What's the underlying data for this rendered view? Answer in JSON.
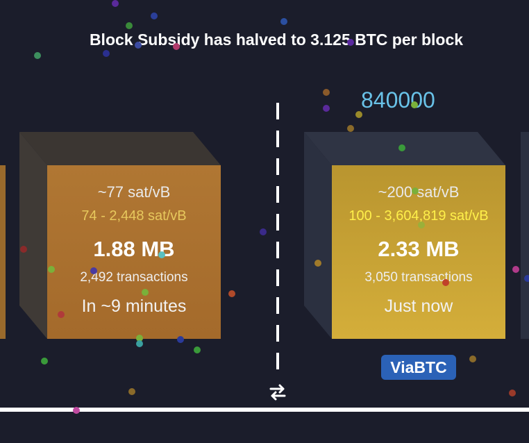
{
  "headline": "Block Subsidy has halved to 3.125 BTC per block",
  "block_height": "840000",
  "blocks": [
    {
      "fee": "~77 sat/vB",
      "fee_range": "74 - 2,448 sat/vB",
      "size": "1.88 MB",
      "transactions": "2,492 transactions",
      "time": "In ~9 minutes"
    },
    {
      "fee": "~200 sat/vB",
      "fee_range": "100 - 3,604,819 sat/vB",
      "size": "2.33 MB",
      "transactions": "3,050 transactions",
      "time": "Just now",
      "pool": "ViaBTC"
    }
  ],
  "colors": {
    "background": "#1b1d2b",
    "mempool_block": "#a8702b",
    "mined_block": "#c9a535",
    "fee_range_mempool": "#e7c85d",
    "fee_range_mined": "#fff04a",
    "height": "#69c2e8",
    "pool_badge": "#2b62b7"
  },
  "icons": {
    "swap": "swap-arrows-icon"
  }
}
